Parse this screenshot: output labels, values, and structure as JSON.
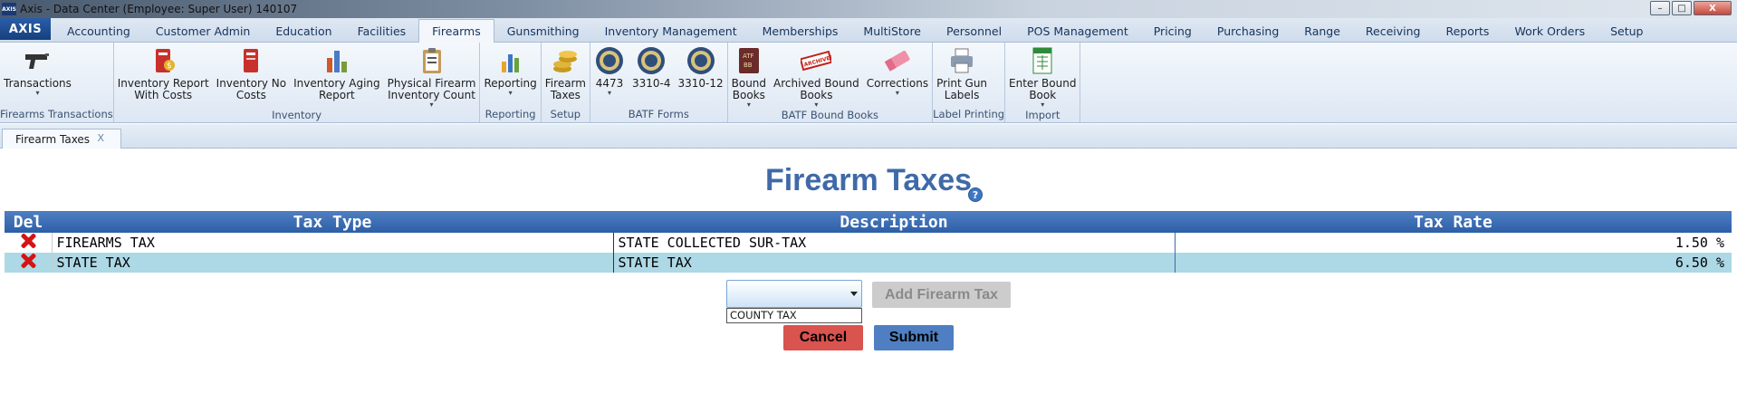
{
  "window": {
    "app_icon_text": "AXIS",
    "title": "Axis - Data Center  (Employee: Super User) 140107",
    "minimize": "–",
    "restore": "□",
    "close": "X"
  },
  "menu": {
    "logo": "AXIS",
    "tabs": [
      {
        "label": "Accounting"
      },
      {
        "label": "Customer Admin"
      },
      {
        "label": "Education"
      },
      {
        "label": "Facilities"
      },
      {
        "label": "Firearms"
      },
      {
        "label": "Gunsmithing"
      },
      {
        "label": "Inventory Management"
      },
      {
        "label": "Memberships"
      },
      {
        "label": "MultiStore"
      },
      {
        "label": "Personnel"
      },
      {
        "label": "POS Management"
      },
      {
        "label": "Pricing"
      },
      {
        "label": "Purchasing"
      },
      {
        "label": "Range"
      },
      {
        "label": "Receiving"
      },
      {
        "label": "Reports"
      },
      {
        "label": "Work Orders"
      },
      {
        "label": "Setup"
      }
    ],
    "active_tab": "Firearms"
  },
  "ribbon": {
    "groups": [
      {
        "label": "Firearms Transactions",
        "buttons": [
          {
            "line1": "Transactions",
            "line2": "",
            "icon": "pistol-icon",
            "dropdown": true
          }
        ]
      },
      {
        "label": "Inventory",
        "buttons": [
          {
            "line1": "Inventory Report",
            "line2": "With Costs",
            "icon": "report-costs-icon",
            "dropdown": false
          },
          {
            "line1": "Inventory No",
            "line2": "Costs",
            "icon": "report-no-costs-icon",
            "dropdown": false
          },
          {
            "line1": "Inventory Aging",
            "line2": "Report",
            "icon": "aging-report-icon",
            "dropdown": false
          },
          {
            "line1": "Physical Firearm",
            "line2": "Inventory Count",
            "icon": "clipboard-icon",
            "dropdown": true
          }
        ]
      },
      {
        "label": "Reporting",
        "buttons": [
          {
            "line1": "Reporting",
            "line2": "",
            "icon": "bar-chart-icon",
            "dropdown": true
          }
        ]
      },
      {
        "label": "Setup",
        "buttons": [
          {
            "line1": "Firearm",
            "line2": "Taxes",
            "icon": "coins-icon",
            "dropdown": false
          }
        ]
      },
      {
        "label": "BATF Forms",
        "buttons": [
          {
            "line1": "4473",
            "line2": "",
            "icon": "seal-icon",
            "dropdown": true
          },
          {
            "line1": "3310-4",
            "line2": "",
            "icon": "seal-icon",
            "dropdown": false
          },
          {
            "line1": "3310-12",
            "line2": "",
            "icon": "seal-icon",
            "dropdown": false
          }
        ]
      },
      {
        "label": "BATF Bound Books",
        "buttons": [
          {
            "line1": "Bound",
            "line2": "Books",
            "icon": "bound-book-icon",
            "dropdown": true
          },
          {
            "line1": "Archived Bound",
            "line2": "Books",
            "icon": "archived-stamp-icon",
            "dropdown": true
          },
          {
            "line1": "Corrections",
            "line2": "",
            "icon": "eraser-icon",
            "dropdown": true
          }
        ]
      },
      {
        "label": "Label Printing",
        "buttons": [
          {
            "line1": "Print Gun",
            "line2": "Labels",
            "icon": "printer-icon",
            "dropdown": false
          }
        ]
      },
      {
        "label": "Import",
        "buttons": [
          {
            "line1": "Enter Bound",
            "line2": "Book",
            "icon": "spreadsheet-icon",
            "dropdown": true
          }
        ]
      }
    ],
    "bound_book_icon_text": "ATF BB",
    "archived_stamp_text": "ARCHIVED"
  },
  "doc_tab": {
    "label": "Firearm Taxes",
    "close": "X"
  },
  "page": {
    "title": "Firearm Taxes",
    "help": "?"
  },
  "table": {
    "headers": {
      "del": "Del",
      "type": "Tax Type",
      "description": "Description",
      "rate": "Tax Rate"
    },
    "rows": [
      {
        "type": "FIREARMS TAX",
        "description": "STATE COLLECTED SUR-TAX",
        "rate": "1.50 %"
      },
      {
        "type": "STATE TAX",
        "description": "STATE TAX",
        "rate": "6.50 %"
      }
    ]
  },
  "form": {
    "select_value": "",
    "dropdown_options": [
      "COUNTY TAX"
    ],
    "add_button": "Add Firearm Tax",
    "cancel_button": "Cancel",
    "submit_button": "Submit"
  },
  "colors": {
    "accent": "#3f6aa8",
    "header_bg": "#2d5fa8",
    "alt_row": "#add8e6",
    "cancel": "#d9534f",
    "submit": "#4f7fc2"
  }
}
